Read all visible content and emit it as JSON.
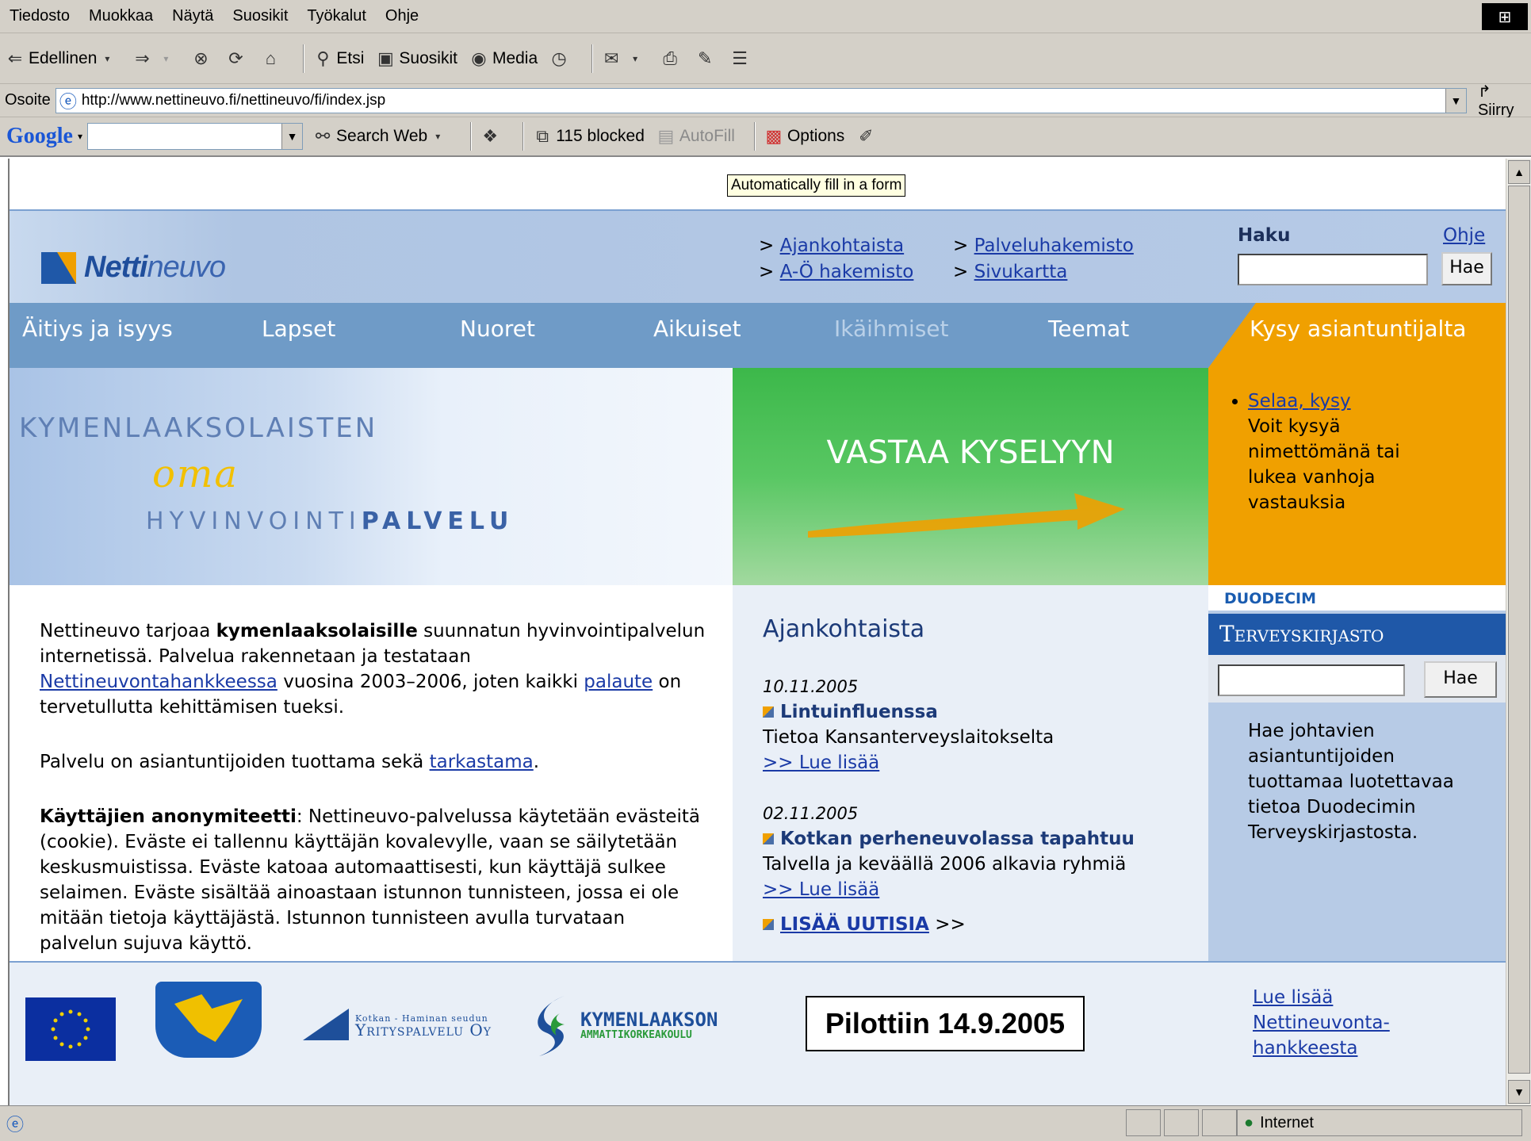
{
  "browser": {
    "menu": [
      "Tiedosto",
      "Muokkaa",
      "Näytä",
      "Suosikit",
      "Työkalut",
      "Ohje"
    ],
    "toolbar": {
      "back": "Edellinen",
      "search": "Etsi",
      "favorites": "Suosikit",
      "media": "Media"
    },
    "address": {
      "label": "Osoite",
      "url": "http://www.nettineuvo.fi/nettineuvo/fi/index.jsp",
      "go": "Siirry"
    },
    "google": {
      "logo": "Google",
      "search_web": "Search Web",
      "blocked": "115 blocked",
      "autofill": "AutoFill",
      "options": "Options",
      "tooltip": "Automatically fill in a form"
    },
    "status": {
      "zone": "Internet"
    }
  },
  "site": {
    "logo": {
      "bold": "Netti",
      "light": "neuvo"
    },
    "top_links_col1": [
      "Ajankohtaista",
      "A-Ö hakemisto"
    ],
    "top_links_col2": [
      "Palveluhakemisto",
      "Sivukartta"
    ],
    "search": {
      "label": "Haku",
      "help": "Ohje",
      "button": "Hae"
    },
    "nav": [
      "Äitiys ja isyys",
      "Lapset",
      "Nuoret",
      "Aikuiset",
      "Ikäihmiset",
      "Teemat"
    ],
    "ask_expert": "Kysy asiantuntijalta",
    "banner": {
      "line1": "KYMENLAAKSOLAISTEN",
      "line2": "oma",
      "line3_a": "HYVINVOINTI",
      "line3_b": "PALVELU",
      "survey": "VASTAA KYSELYYN"
    },
    "ask_box": {
      "link": "Selaa, kysy",
      "text": "Voit kysyä nimettömänä tai lukea vanhoja vastauksia"
    },
    "intro": {
      "p1_a": "Nettineuvo tarjoaa ",
      "p1_bold": "kymenlaaksolaisille",
      "p1_b": " suunnatun hyvinvointipalvelun internetissä. Palvelua rakennetaan ja testataan ",
      "p1_link1": "Nettineuvontahankkeessa",
      "p1_c": " vuosina 2003–2006, joten kaikki ",
      "p1_link2": "palaute",
      "p1_d": " on tervetullutta kehittämisen tueksi.",
      "p2_a": "Palvelu on asiantuntijoiden tuottama sekä ",
      "p2_link": "tarkastama",
      "p2_b": ".",
      "p3_bold": "Käyttäjien anonymiteetti",
      "p3_text": ": Nettineuvo-palvelussa käytetään evästeitä (cookie). Eväste ei tallennu käyttäjän kovalevylle, vaan se säilytetään keskusmuistissa. Eväste katoaa automaattisesti, kun käyttäjä sulkee selaimen. Eväste sisältää ainoastaan istunnon tunnisteen, jossa ei ole mitään tietoja käyttäjästä. Istunnon tunnisteen avulla turvataan palvelun sujuva käyttö."
    },
    "news": {
      "heading": "Ajankohtaista",
      "items": [
        {
          "date": "10.11.2005",
          "title": "Lintuinfluenssa",
          "desc": "Tietoa Kansanterveyslaitokselta",
          "more": ">> Lue lisää"
        },
        {
          "date": "02.11.2005",
          "title": "Kotkan perheneuvolassa tapahtuu",
          "desc": "Talvella ja keväällä 2006 alkavia ryhmiä",
          "more": ">> Lue lisää"
        }
      ],
      "more_news": "LISÄÄ UUTISIA",
      "more_arrows": ">>"
    },
    "terveyskirjasto": {
      "brand": "DUODECIM",
      "title": "Terveyskirjasto",
      "button": "Hae",
      "text": "Hae johtavien asiantuntijoiden tuottamaa luotettavaa tietoa Duodecimin Terveyskirjastosta."
    },
    "footer": {
      "kotka_small": "Kotkan - Haminan seudun",
      "kotka_big": "Yrityspalvelu Oy",
      "kymen_big": "KYMENLAAKSON",
      "kymen_small": "AMMATTIKORKEAKOULU",
      "pilot": "Pilottiin 14.9.2005",
      "link": [
        "Lue lisää",
        "Nettineuvonta-",
        "hankkeesta"
      ]
    }
  }
}
